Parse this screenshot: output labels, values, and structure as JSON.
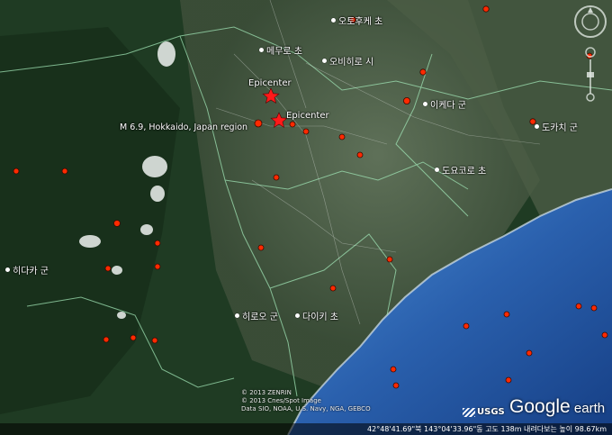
{
  "map": {
    "epicenters": [
      {
        "label": "Epicenter"
      },
      {
        "label": "Epicenter"
      }
    ],
    "event_label": "M 6.9, Hokkaido, Japan region",
    "place_names": [
      {
        "name": "오토후케 초"
      },
      {
        "name": "메무로 초"
      },
      {
        "name": "오비히로 시"
      },
      {
        "name": "이케다 군"
      },
      {
        "name": "도카치 군"
      },
      {
        "name": "도요코로 초"
      },
      {
        "name": "히다카 군"
      },
      {
        "name": "히로오 군"
      },
      {
        "name": "다이키 초"
      }
    ],
    "copyright": [
      "© 2013 ZENRIN",
      "© 2013 Cnes/Spot Image",
      "Data SIO, NOAA, U.S. Navy, NGA, GEBCO"
    ],
    "status_bar": "42°48'41.69\"북 143°04'33.96\"동  고도  138m     내려다보는 높이  98.67km",
    "usgs_label": "USGS",
    "logo": {
      "part1": "Google",
      "part2": " earth"
    },
    "colors": {
      "marker": "#ff2a00",
      "epicenter": "#ff1a1a",
      "sea": "#2f6fc0",
      "forest": "#1f3b23"
    },
    "icons": [
      "epicenter-star-icon",
      "earthquake-marker-icon",
      "compass-icon",
      "zoom-slider-icon"
    ]
  }
}
